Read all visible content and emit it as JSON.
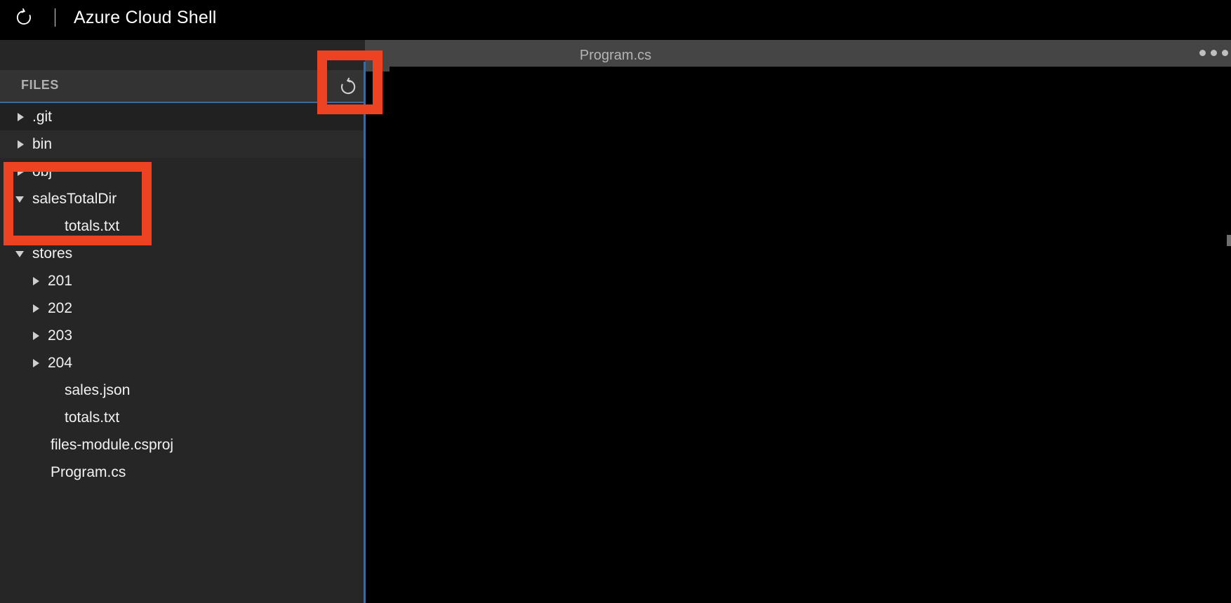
{
  "shell": {
    "restart_icon": "refresh-icon",
    "title": "Azure Cloud Shell"
  },
  "editor_tabs": {
    "active_tab": "Program.cs",
    "overflow_icon": "ellipsis-icon",
    "content": ""
  },
  "files_panel": {
    "header": "FILES",
    "refresh_icon": "refresh-icon",
    "tree": [
      {
        "label": ".git",
        "state": "collapsed",
        "indent": 0,
        "kind": "folder"
      },
      {
        "label": "bin",
        "state": "collapsed",
        "indent": 0,
        "kind": "folder"
      },
      {
        "label": "obj",
        "state": "collapsed",
        "indent": 0,
        "kind": "folder"
      },
      {
        "label": "salesTotalDir",
        "state": "expanded",
        "indent": 0,
        "kind": "folder"
      },
      {
        "label": "totals.txt",
        "state": "leaf",
        "indent": 1,
        "kind": "file"
      },
      {
        "label": "stores",
        "state": "expanded",
        "indent": 0,
        "kind": "folder"
      },
      {
        "label": "201",
        "state": "collapsed",
        "indent": 1,
        "kind": "folder"
      },
      {
        "label": "202",
        "state": "collapsed",
        "indent": 1,
        "kind": "folder"
      },
      {
        "label": "203",
        "state": "collapsed",
        "indent": 1,
        "kind": "folder"
      },
      {
        "label": "204",
        "state": "collapsed",
        "indent": 1,
        "kind": "folder"
      },
      {
        "label": "sales.json",
        "state": "leaf",
        "indent": 2,
        "kind": "file"
      },
      {
        "label": "totals.txt",
        "state": "leaf",
        "indent": 2,
        "kind": "file"
      },
      {
        "label": "files-module.csproj",
        "state": "leaf",
        "indent": 1,
        "kind": "file"
      },
      {
        "label": "Program.cs",
        "state": "leaf",
        "indent": 1,
        "kind": "file"
      }
    ]
  },
  "annotations": {
    "color": "#ee4323",
    "boxes": [
      {
        "name": "refresh-files-button-highlight"
      },
      {
        "name": "salestotaldir-highlight"
      }
    ]
  },
  "colors": {
    "shell_bar_bg": "#000000",
    "tabstrip_bg": "#454545",
    "panel_bg": "#262626",
    "panel_header_bg": "#333333",
    "accent_rule": "#3d6a9c",
    "editor_bg": "#000000",
    "annotation_red": "#ee4323"
  }
}
